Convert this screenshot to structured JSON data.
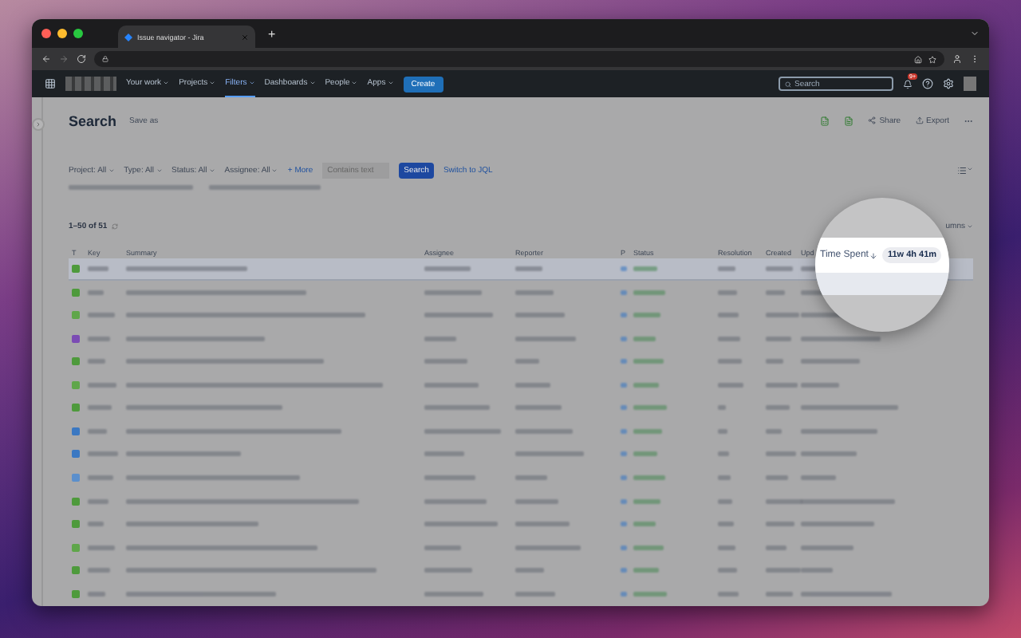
{
  "browser": {
    "tab_title": "Issue navigator - Jira",
    "new_tab": "+"
  },
  "nav": {
    "items": [
      {
        "label": "Your work",
        "selected": false
      },
      {
        "label": "Projects",
        "selected": false
      },
      {
        "label": "Filters",
        "selected": true
      },
      {
        "label": "Dashboards",
        "selected": false
      },
      {
        "label": "People",
        "selected": false
      },
      {
        "label": "Apps",
        "selected": false
      }
    ],
    "create": "Create",
    "search_placeholder": "Search",
    "notification_count": "9+"
  },
  "page": {
    "title": "Search",
    "save_as": "Save as",
    "actions": [
      "Share",
      "Export"
    ]
  },
  "filters": {
    "dropdowns": [
      "Project: All",
      "Type: All",
      "Status: All",
      "Assignee: All"
    ],
    "more": "+ More",
    "text_placeholder": "Contains text",
    "search_button": "Search",
    "jql_link": "Switch to JQL"
  },
  "results": {
    "count": "1–50 of 51",
    "columns_button": "umns"
  },
  "table": {
    "columns": [
      "T",
      "Key",
      "Summary",
      "Assignee",
      "Reporter",
      "P",
      "Status",
      "Resolution",
      "Created",
      "Upd"
    ],
    "rows": [
      {
        "color": "#4e9a3c",
        "selected": true
      },
      {
        "color": "#4e9a3c",
        "selected": false
      },
      {
        "color": "#5fa64a",
        "selected": false
      },
      {
        "color": "#7b4cb4",
        "selected": false
      },
      {
        "color": "#4e9a3c",
        "selected": false
      },
      {
        "color": "#5fa64a",
        "selected": false
      },
      {
        "color": "#4e9a3c",
        "selected": false
      },
      {
        "color": "#3b78c2",
        "selected": false
      },
      {
        "color": "#3b78c2",
        "selected": false
      },
      {
        "color": "#5b8fcc",
        "selected": false
      },
      {
        "color": "#4e9a3c",
        "selected": false
      },
      {
        "color": "#4e9a3c",
        "selected": false
      },
      {
        "color": "#5fa64a",
        "selected": false
      },
      {
        "color": "#4e9a3c",
        "selected": false
      },
      {
        "color": "#4e9a3c",
        "selected": false
      }
    ]
  },
  "magnifier": {
    "column": "Time Spent",
    "value": "11w 4h 41m"
  }
}
